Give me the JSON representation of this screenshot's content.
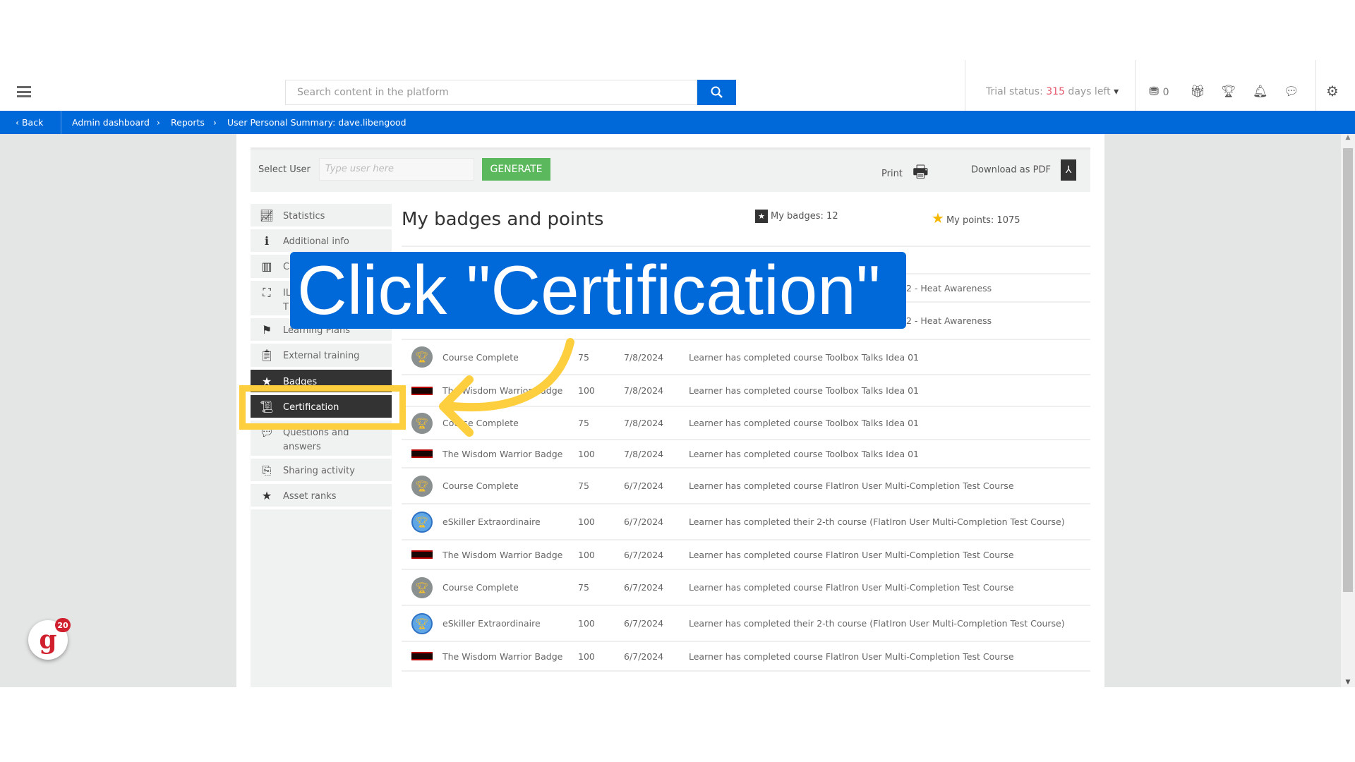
{
  "header": {
    "search_placeholder": "Search content in the platform",
    "trial_prefix": "Trial status: ",
    "trial_days": "315",
    "trial_suffix": " days left",
    "coins": "0",
    "accent": "#0069d9"
  },
  "breadcrumb": {
    "back": "Back",
    "items": [
      "Admin dashboard",
      "Reports",
      "User Personal Summary: dave.libengood"
    ]
  },
  "toolbar": {
    "select_user_label": "Select User",
    "user_placeholder": "Type user here",
    "generate": "GENERATE",
    "print": "Print",
    "download_pdf": "Download as PDF"
  },
  "sidebar": {
    "items": [
      {
        "label": "Statistics",
        "icon": "chart-line-icon"
      },
      {
        "label": "Additional info",
        "icon": "info-icon"
      },
      {
        "label": "C",
        "icon": "courses-icon"
      },
      {
        "label": "IL",
        "label2": "T",
        "icon": "presentation-icon"
      },
      {
        "label": "Learning Plans",
        "icon": "signpost-icon"
      },
      {
        "label": "External training",
        "icon": "clipboard-icon"
      },
      {
        "label": "Badges",
        "icon": "badge-star-icon",
        "active": true
      },
      {
        "label": "Certification",
        "icon": "certificate-icon",
        "active": true
      },
      {
        "label": "Questions and",
        "label2": "answers",
        "icon": "chat-icon"
      },
      {
        "label": "Sharing activity",
        "icon": "share-file-icon"
      },
      {
        "label": "Asset ranks",
        "icon": "star-icon"
      }
    ]
  },
  "main": {
    "title": "My badges and points",
    "my_badges": "My badges: 12",
    "my_points": "My points: 1075",
    "rows": [
      {
        "badge": "",
        "name": "",
        "points": "",
        "date": "",
        "desc": ""
      },
      {
        "badge": "hidden",
        "name": "",
        "points": "",
        "date": "",
        "desc": "2 - Heat Awareness"
      },
      {
        "badge": "hidden",
        "name": "",
        "points": "",
        "date": "",
        "desc": "2 - Heat Awareness"
      },
      {
        "badge": "trophy",
        "name": "Course Complete",
        "points": "75",
        "date": "7/8/2024",
        "desc": "Learner has completed course Toolbox Talks Idea 01"
      },
      {
        "badge": "banner",
        "name": "The Wisdom Warrior Badge",
        "points": "100",
        "date": "7/8/2024",
        "desc": "Learner has completed course Toolbox Talks Idea 01"
      },
      {
        "badge": "trophy",
        "name": "Course Complete",
        "points": "75",
        "date": "7/8/2024",
        "desc": "Learner has completed course Toolbox Talks Idea 01"
      },
      {
        "badge": "banner",
        "name": "The Wisdom Warrior Badge",
        "points": "100",
        "date": "7/8/2024",
        "desc": "Learner has completed course Toolbox Talks Idea 01"
      },
      {
        "badge": "trophy",
        "name": "Course Complete",
        "points": "75",
        "date": "6/7/2024",
        "desc": "Learner has completed course FlatIron User Multi-Completion Test Course"
      },
      {
        "badge": "trophy-blue",
        "name": "eSkiller Extraordinaire",
        "points": "100",
        "date": "6/7/2024",
        "desc": "Learner has completed their 2-th course (FlatIron User Multi-Completion Test Course)"
      },
      {
        "badge": "banner",
        "name": "The Wisdom Warrior Badge",
        "points": "100",
        "date": "6/7/2024",
        "desc": "Learner has completed course FlatIron User Multi-Completion Test Course"
      },
      {
        "badge": "trophy",
        "name": "Course Complete",
        "points": "75",
        "date": "6/7/2024",
        "desc": "Learner has completed course FlatIron User Multi-Completion Test Course"
      },
      {
        "badge": "trophy-blue",
        "name": "eSkiller Extraordinaire",
        "points": "100",
        "date": "6/7/2024",
        "desc": "Learner has completed their 2-th course (FlatIron User Multi-Completion Test Course)"
      },
      {
        "badge": "banner",
        "name": "The Wisdom Warrior Badge",
        "points": "100",
        "date": "6/7/2024",
        "desc": "Learner has completed course FlatIron User Multi-Completion Test Course"
      }
    ]
  },
  "overlay": {
    "text": "Click \"Certification\"",
    "highlight_color": "#fdcf3e"
  },
  "widget": {
    "logo": "g",
    "count": "20"
  }
}
